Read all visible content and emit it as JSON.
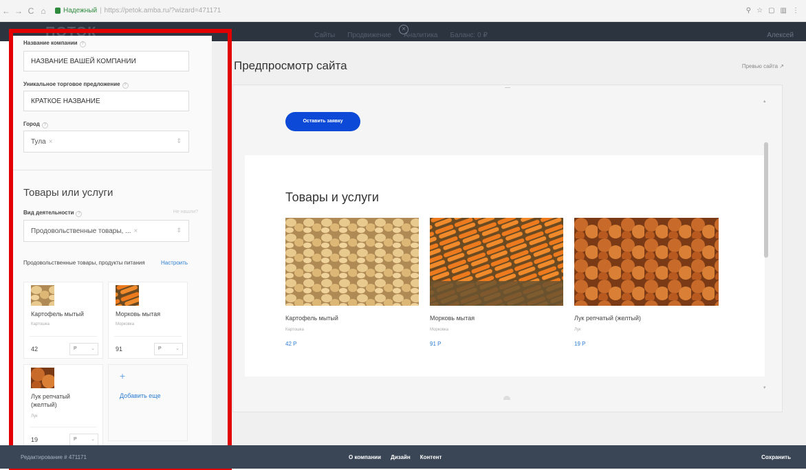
{
  "browser": {
    "secure_label": "Надежный",
    "url": "https://petok.amba.ru/?wizard=471171"
  },
  "app_header": {
    "logo": "ПОТОК",
    "nav": [
      "Сайты",
      "Продвижение",
      "Аналитика",
      "Баланс: 0 ₽"
    ],
    "user": "Алексей"
  },
  "left_panel": {
    "company_name_label": "Название компании",
    "company_name_value": "НАЗВАНИЕ ВАШЕЙ КОМПАНИИ",
    "usp_label": "Уникальное торговое предложение",
    "usp_value": "КРАТКОЕ НАЗВАНИЕ",
    "city_label": "Город",
    "city_value": "Тула",
    "section_title": "Товары или услуги",
    "activity_label": "Вид деятельности",
    "not_found": "Не нашли?",
    "activity_value": "Продовольственные товары, ...",
    "category_name": "Продовольственные товары, продукты питания",
    "configure": "Настроить",
    "cards": [
      {
        "name": "Картофель мытый",
        "category": "Картошка",
        "price": "42",
        "currency": "Р"
      },
      {
        "name": "Морковь мытая",
        "category": "Морковка",
        "price": "91",
        "currency": "Р"
      },
      {
        "name": "Лук репчатый (желтый)",
        "category": "Лук",
        "price": "19",
        "currency": "Р"
      }
    ],
    "add_more": "Добавить еще"
  },
  "preview": {
    "title": "Предпросмотр сайта",
    "link": "Превью сайта",
    "cta": "Оставить заявку",
    "products_title": "Товары и услуги",
    "products": [
      {
        "name": "Картофель мытый",
        "category": "Картошка",
        "price": "42 Р"
      },
      {
        "name": "Морковь мытая",
        "category": "Морковка",
        "price": "91 Р"
      },
      {
        "name": "Лук репчатый (желтый)",
        "category": "Лук",
        "price": "19 Р"
      }
    ]
  },
  "bottom_bar": {
    "editing": "Редактирование # 471171",
    "tabs": [
      "О компании",
      "Дизайн",
      "Контент"
    ],
    "save": "Сохранить"
  },
  "colors": {
    "accent": "#0b49d6",
    "link": "#2b7cd3",
    "highlight_frame": "#e30000",
    "bottom_bar": "#3a4656"
  }
}
